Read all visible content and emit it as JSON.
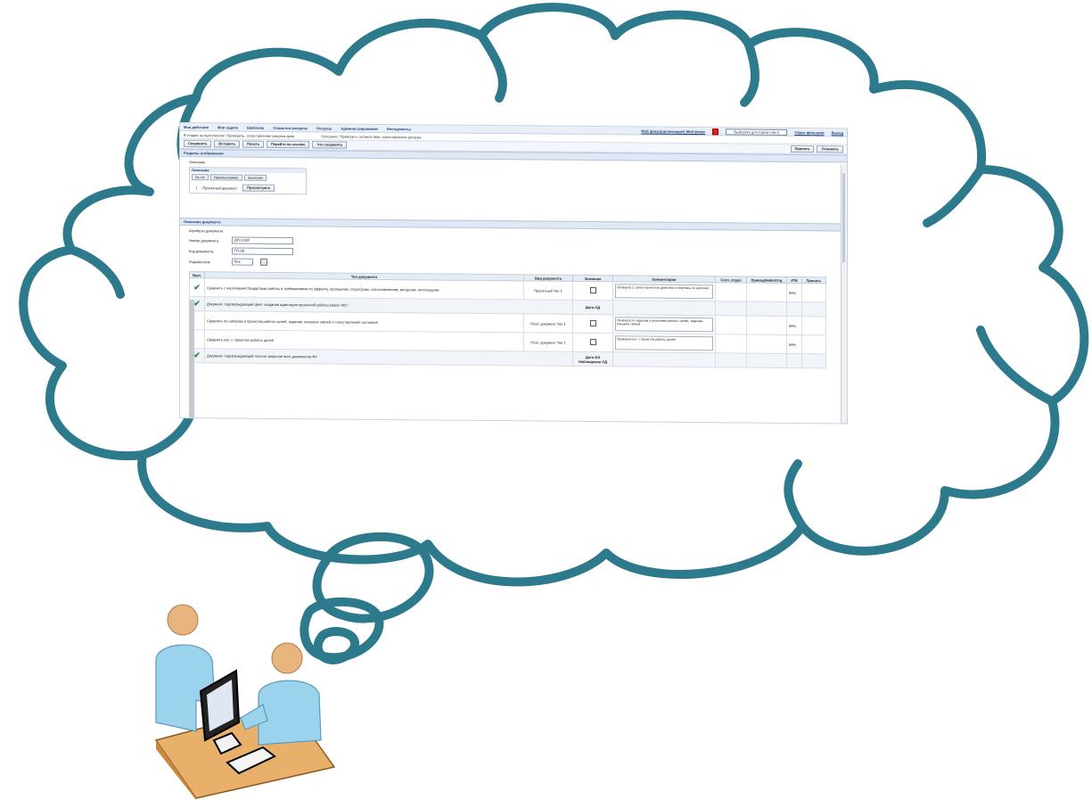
{
  "app": {
    "menu": [
      "Мои действия",
      "Мои задачи",
      "Шаблоны",
      "Открытые ресурсы",
      "Ресурсы",
      "Администрирование",
      "Инструменты"
    ],
    "menu_right_link": "Мой фокус(организация) Мой фокус",
    "menu_right_select": "Выберите для Связи (лист)",
    "menu_right_links": [
      "Сброс фильтров",
      "Выход"
    ],
    "crumbs": [
      "В стадии на выполнение: Проверить, сопоставление рисунка деян",
      "Описание: Проверить соответствие, сопоставление рисунка"
    ],
    "toolbar_left": [
      "Сохранить",
      "Вставить",
      "Печать",
      "Перейти по ссылке",
      "Что сохранять"
    ],
    "toolbar_right": [
      "Принять",
      "Отменить"
    ],
    "section1_title": "Разделы отображения",
    "section1_label": "Описание",
    "subbox_header": "Описание",
    "subbox_tabs": [
      "№ п/п",
      "Наименование",
      "Значение"
    ],
    "subbox_row": [
      "1",
      "Проектный документ",
      "Просмотреть"
    ],
    "section2_title": "Описание документа",
    "section2_label": "Атрибуты документа",
    "fields": [
      {
        "label": "Номер документа",
        "value": "ДП-1/180"
      },
      {
        "label": "Код документа",
        "value": "ГП-28"
      },
      {
        "label": "Разработчик",
        "value": "Все"
      }
    ],
    "columns": [
      "Вып.",
      "Тип документа",
      "Вид документа",
      "Значение",
      "Комментарии",
      "Согл. отдел",
      "Привод/Набл/Отд",
      "ЛТК",
      "Принять"
    ],
    "rows": [
      {
        "type": "data",
        "check": true,
        "text": "Сравнить с чертежами/стандартами работы и требованиями по эффекту, принципам, структурам, сопоставлениям, ресурсам, интеграциям",
        "kind": "Проектный\nТип 1",
        "note": "Проверка 1: самое проектное действие и перечень по работам...",
        "pct": "99%"
      },
      {
        "type": "group",
        "check": true,
        "text": "Документ, подтверждающий факт создания адаптации проектной работы (макет ФУ)",
        "value": "Дата ОД"
      },
      {
        "type": "data",
        "check": false,
        "text": "Сравнить по наборам и проектам работы целей, задачам, внешних связей и сопоставлений состояния",
        "kind": "Плат. документ\nТип 1",
        "note": "Проверка по задачам и решениям работы, целей, задачам, внешних связей",
        "pct": "99%"
      },
      {
        "type": "data",
        "check": false,
        "text": "Сравнить кол. с проектом работы целей",
        "kind": "Плат. документ\nТип 1",
        "note": "Проверка кол. с проектом работы целей",
        "pct": "99%"
      },
      {
        "type": "group",
        "check": true,
        "text": "Документ, подтверждающий полное закрытие всех документов ФУ",
        "value": "Дата ФЗ\nНаблюдение ОД"
      }
    ]
  },
  "colors": {
    "cloud_stroke": "#2c7a8c",
    "header_blue": "#1b3d78",
    "check_green": "#2e8b2e"
  }
}
